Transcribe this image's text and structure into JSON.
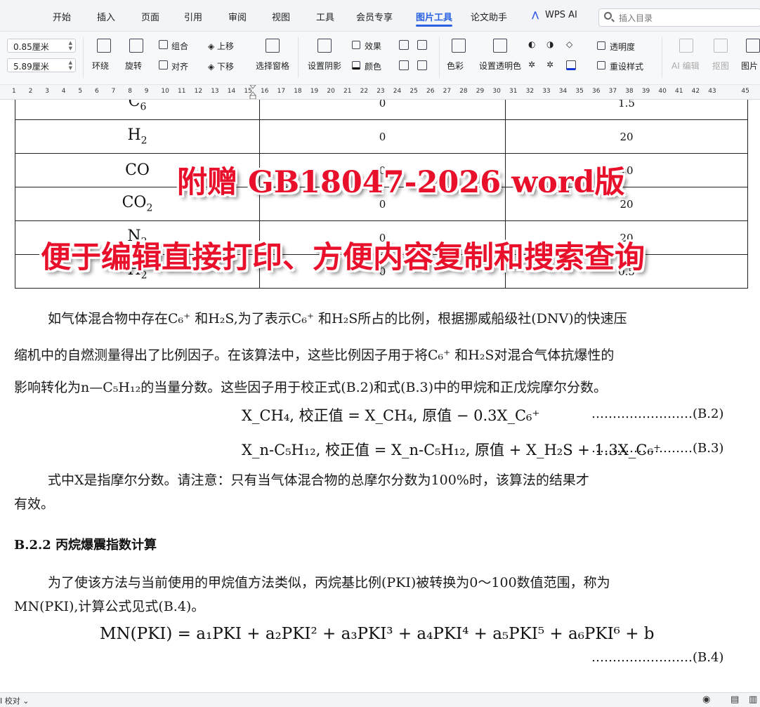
{
  "menubar": {
    "items": [
      "开始",
      "插入",
      "页面",
      "引用",
      "审阅",
      "视图",
      "工具",
      "会员专享",
      "图片工具",
      "论文助手",
      "WPS AI"
    ],
    "active": "图片工具",
    "search_placeholder": "插入目录"
  },
  "toolbar": {
    "height_value": "0.85厘米",
    "width_value": "5.89厘米",
    "wrap": "环绕",
    "rotate": "旋转",
    "group": "组合",
    "align": "对齐",
    "move_up": "上移",
    "move_down": "下移",
    "selection_pane": "选择窗格",
    "shadow": "设置阴影",
    "effect": "效果",
    "color": "颜色",
    "color_mode": "色彩",
    "transparent_color": "设置透明色",
    "transparency": "透明度",
    "reset_style": "重设样式",
    "ai_edit": "AI 编辑",
    "cutout": "抠图",
    "picture": "图片"
  },
  "ruler": {
    "numbers": [
      "1",
      "2",
      "3",
      "4",
      "5",
      "6",
      "7",
      "8",
      "9",
      "10",
      "11",
      "12",
      "13",
      "14",
      "15",
      "16",
      "17",
      "18",
      "19",
      "20",
      "21",
      "22",
      "23",
      "24",
      "25",
      "26",
      "27",
      "28",
      "29",
      "30",
      "31",
      "32",
      "33",
      "34",
      "35",
      "36",
      "37",
      "38",
      "39",
      "40",
      "41",
      "42",
      "43",
      "45"
    ]
  },
  "table": {
    "rows": [
      {
        "base": "C",
        "sub": "6",
        "a": "0",
        "b": "1.5"
      },
      {
        "base": "H",
        "sub": "2",
        "a": "0",
        "b": "20"
      },
      {
        "base": "CO",
        "sub": "",
        "a": "0",
        "b": "10"
      },
      {
        "base": "CO",
        "sub": "2",
        "a": "0",
        "b": "20"
      },
      {
        "base": "N",
        "sub": "2",
        "a": "0",
        "b": "20"
      },
      {
        "base": "H",
        "sub": "2",
        "a": "0",
        "b": "0.5"
      }
    ]
  },
  "banner": {
    "line1": "附赠 GB18047-2026 word版",
    "line2": "便于编辑直接打印、方便内容复制和搜索查询"
  },
  "body": {
    "para1_line1": "如气体混合物中存在C₆⁺ 和H₂S,为了表示C₆⁺ 和H₂S所占的比例，根据挪威船级社(DNV)的快速压",
    "para1_line2": "缩机中的自燃测量得出了比例因子。在该算法中，这些比例因子用于将C₆⁺ 和H₂S对混合气体抗爆性的",
    "para1_line3": "影响转化为n—C₅H₁₂的当量分数。这些因子用于校正式(B.2)和式(B.3)中的甲烷和正戊烷摩尔分数。",
    "eq2_text": "X_CH₄, 校正值 = X_CH₄, 原值 − 0.3X_C₆⁺",
    "eq2_no": "……………………(B.2)",
    "eq3_text": "X_n-C₅H₁₂, 校正值 = X_n-C₅H₁₂, 原值 + X_H₂S + 1.3X_C₆⁺",
    "eq3_no": "……………………(B.3)",
    "para2_line1": "式中X是指摩尔分数。请注意：只有当气体混合物的总摩尔分数为100%时，该算法的结果才",
    "para2_line2": "有效。",
    "heading": "B.2.2  丙烷爆震指数计算",
    "para3_line1": "为了使该方法与当前使用的甲烷值方法类似，丙烷基比例(PKI)被转换为0～100数值范围，称为",
    "para3_line2": "MN(PKI),计算公式见式(B.4)。",
    "eq4_text": "MN(PKI) = a₁PKI + a₂PKI² + a₃PKI³ + a₄PKI⁴ + a₅PKI⁵ + a₆PKI⁶ + b",
    "eq4_no": "……………………(B.4)"
  },
  "statusbar": {
    "proofread": "校对"
  }
}
